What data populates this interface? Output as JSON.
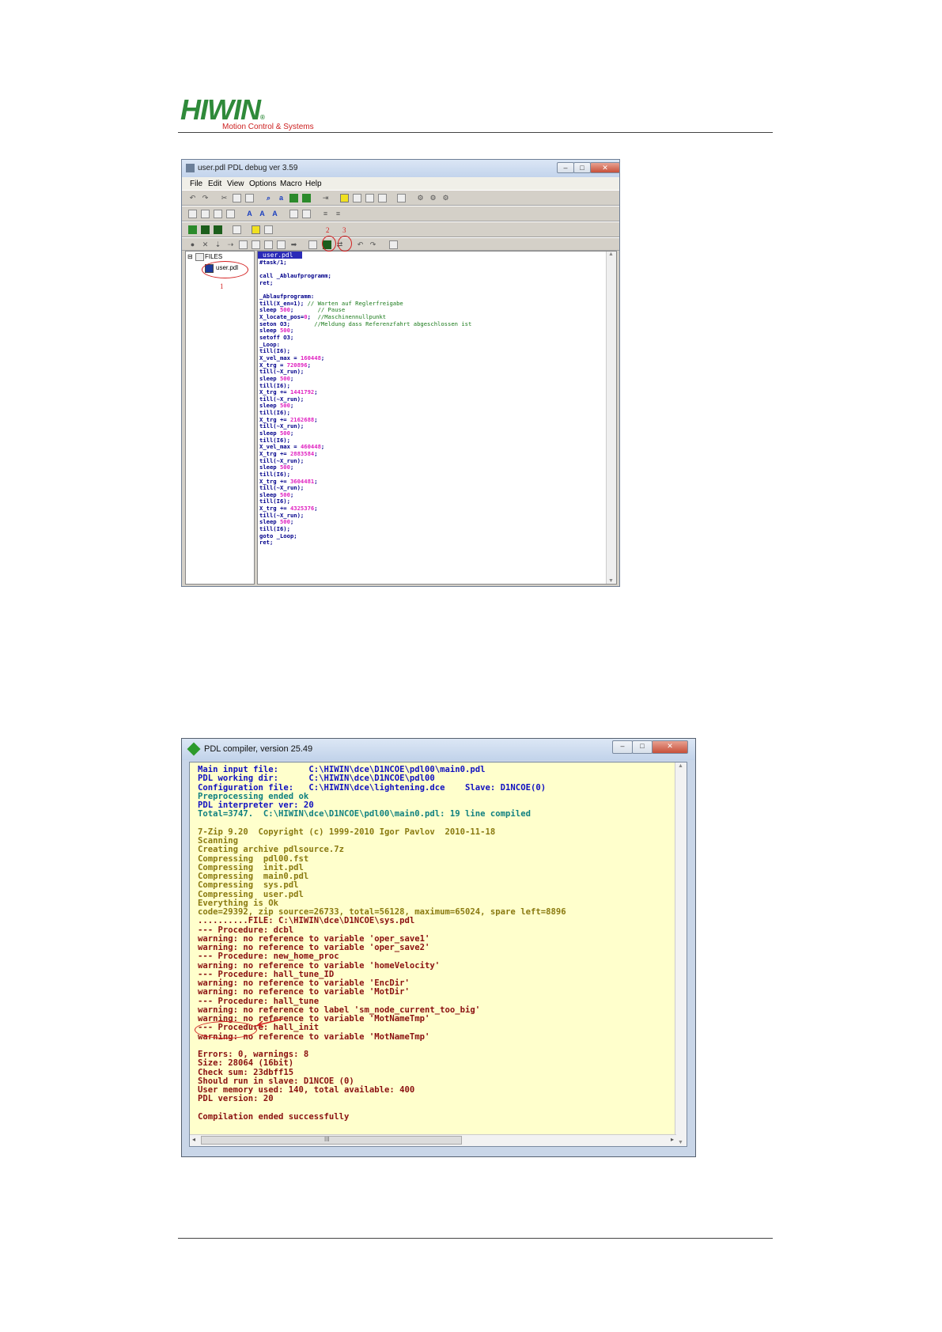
{
  "header": {
    "brand": "HIWIN",
    "brand_mark": "®",
    "tagline": "Motion Control & Systems"
  },
  "debugger": {
    "title": "user.pdl   PDL debug ver 3.59",
    "menu": [
      "File",
      "Edit",
      "View",
      "Options",
      "Macro",
      "Help"
    ],
    "tree_root": "FILES",
    "tree_file": "user.pdl",
    "editor_tab": "user.pdl",
    "annotations": [
      "1",
      "2",
      "3"
    ],
    "code_lines": [
      [
        [
          "#task/1;",
          "k"
        ]
      ],
      [
        [
          "",
          "k"
        ]
      ],
      [
        [
          "call _Ablaufprogramm;",
          "k"
        ]
      ],
      [
        [
          "ret;",
          "k"
        ]
      ],
      [
        [
          "",
          "k"
        ]
      ],
      [
        [
          "_Ablaufprogramm:",
          "k"
        ]
      ],
      [
        [
          "till(X_en=1); ",
          "k"
        ],
        [
          "// Warten auf Reglerfreigabe",
          "c"
        ]
      ],
      [
        [
          "sleep ",
          "k"
        ],
        [
          "500",
          "n"
        ],
        [
          ";       ",
          "k"
        ],
        [
          "// Pause",
          "c"
        ]
      ],
      [
        [
          "X_locate_pos=",
          "k"
        ],
        [
          "0",
          "n"
        ],
        [
          ";  ",
          "k"
        ],
        [
          "//Maschinennullpunkt",
          "c"
        ]
      ],
      [
        [
          "seton O3;       ",
          "k"
        ],
        [
          "//Meldung dass Referenzfahrt abgeschlossen ist",
          "c"
        ]
      ],
      [
        [
          "sleep ",
          "k"
        ],
        [
          "500",
          "n"
        ],
        [
          ";",
          "k"
        ]
      ],
      [
        [
          "setoff O3;",
          "k"
        ]
      ],
      [
        [
          "_Loop:",
          "k"
        ]
      ],
      [
        [
          "till(I6);",
          "k"
        ]
      ],
      [
        [
          "X_vel_max = ",
          "k"
        ],
        [
          "160448",
          "n"
        ],
        [
          ";",
          "k"
        ]
      ],
      [
        [
          "X_trg = ",
          "k"
        ],
        [
          "720896",
          "n"
        ],
        [
          ";",
          "k"
        ]
      ],
      [
        [
          "till(~X_run);",
          "k"
        ]
      ],
      [
        [
          "sleep ",
          "k"
        ],
        [
          "500",
          "n"
        ],
        [
          ";",
          "k"
        ]
      ],
      [
        [
          "till(I6);",
          "k"
        ]
      ],
      [
        [
          "X_trg += ",
          "k"
        ],
        [
          "1441792",
          "n"
        ],
        [
          ";",
          "k"
        ]
      ],
      [
        [
          "till(~X_run);",
          "k"
        ]
      ],
      [
        [
          "sleep ",
          "k"
        ],
        [
          "500",
          "n"
        ],
        [
          ";",
          "k"
        ]
      ],
      [
        [
          "till(I6);",
          "k"
        ]
      ],
      [
        [
          "X_trg += ",
          "k"
        ],
        [
          "2162688",
          "n"
        ],
        [
          ";",
          "k"
        ]
      ],
      [
        [
          "till(~X_run);",
          "k"
        ]
      ],
      [
        [
          "sleep ",
          "k"
        ],
        [
          "500",
          "n"
        ],
        [
          ";",
          "k"
        ]
      ],
      [
        [
          "till(I6);",
          "k"
        ]
      ],
      [
        [
          "X_vel_max = ",
          "k"
        ],
        [
          "460448",
          "n"
        ],
        [
          ";",
          "k"
        ]
      ],
      [
        [
          "X_trg += ",
          "k"
        ],
        [
          "2883584",
          "n"
        ],
        [
          ";",
          "k"
        ]
      ],
      [
        [
          "till(~X_run);",
          "k"
        ]
      ],
      [
        [
          "sleep ",
          "k"
        ],
        [
          "500",
          "n"
        ],
        [
          ";",
          "k"
        ]
      ],
      [
        [
          "till(I6);",
          "k"
        ]
      ],
      [
        [
          "X_trg += ",
          "k"
        ],
        [
          "3604481",
          "n"
        ],
        [
          ";",
          "k"
        ]
      ],
      [
        [
          "till(~X_run);",
          "k"
        ]
      ],
      [
        [
          "sleep ",
          "k"
        ],
        [
          "500",
          "n"
        ],
        [
          ";",
          "k"
        ]
      ],
      [
        [
          "till(I6);",
          "k"
        ]
      ],
      [
        [
          "X_trg += ",
          "k"
        ],
        [
          "4325376",
          "n"
        ],
        [
          ";",
          "k"
        ]
      ],
      [
        [
          "till(~X_run);",
          "k"
        ]
      ],
      [
        [
          "sleep ",
          "k"
        ],
        [
          "500",
          "n"
        ],
        [
          ";",
          "k"
        ]
      ],
      [
        [
          "till(I6);",
          "k"
        ]
      ],
      [
        [
          "goto _Loop;",
          "k"
        ]
      ],
      [
        [
          "ret;",
          "k"
        ]
      ]
    ]
  },
  "compiler": {
    "title": "PDL compiler, version 25.49",
    "scroll_mark": "III",
    "lines": [
      [
        "Main input file:      C:\\HIWIN\\dce\\D1NCOE\\pdl00\\main0.pdl",
        "blue"
      ],
      [
        "PDL working dir:      C:\\HIWIN\\dce\\D1NCOE\\pdl00",
        "blue"
      ],
      [
        "Configuration file:   C:\\HIWIN\\dce\\lightening.dce    Slave: D1NCOE(0)",
        "blue"
      ],
      [
        "Preprocessing ended ok",
        "teal"
      ],
      [
        "PDL interpreter ver: 20",
        "blue"
      ],
      [
        "Total=3747.  C:\\HIWIN\\dce\\D1NCOE\\pdl00\\main0.pdl: 19 line compiled",
        "teal"
      ],
      [
        "",
        "blue"
      ],
      [
        "7-Zip 9.20  Copyright (c) 1999-2010 Igor Pavlov  2010-11-18",
        "ol"
      ],
      [
        "Scanning",
        "ol"
      ],
      [
        "Creating archive pdlsource.7z",
        "ol"
      ],
      [
        "Compressing  pdl00.fst",
        "ol"
      ],
      [
        "Compressing  init.pdl",
        "ol"
      ],
      [
        "Compressing  main0.pdl",
        "ol"
      ],
      [
        "Compressing  sys.pdl",
        "ol"
      ],
      [
        "Compressing  user.pdl",
        "ol"
      ],
      [
        "Everything is Ok",
        "ol"
      ],
      [
        "code=29392, zip source=26733, total=56128, maximum=65024, spare left=8896",
        "ol"
      ],
      [
        "..........FILE: C:\\HIWIN\\dce\\D1NCOE\\sys.pdl",
        "red"
      ],
      [
        "--- Procedure: dcbl",
        "red"
      ],
      [
        "warning: no reference to variable 'oper_save1'",
        "red"
      ],
      [
        "warning: no reference to variable 'oper_save2'",
        "red"
      ],
      [
        "--- Procedure: new_home_proc",
        "red"
      ],
      [
        "warning: no reference to variable 'homeVelocity'",
        "red"
      ],
      [
        "--- Procedure: hall_tune_ID",
        "red"
      ],
      [
        "warning: no reference to variable 'EncDir'",
        "red"
      ],
      [
        "warning: no reference to variable 'MotDir'",
        "red"
      ],
      [
        "--- Procedure: hall_tune",
        "red"
      ],
      [
        "warning: no reference to label 'sm_node_current_too_big'",
        "red"
      ],
      [
        "warning: no reference to variable 'MotNameTmp'",
        "red"
      ],
      [
        "--- Procedure: hall_init",
        "red"
      ],
      [
        "warning: no reference to variable 'MotNameTmp'",
        "red"
      ],
      [
        "",
        "red"
      ],
      [
        "Errors: 0, warnings: 8",
        "red"
      ],
      [
        "Size: 28064 (16bit)",
        "red"
      ],
      [
        "Check sum: 23dbff15",
        "red"
      ],
      [
        "Should run in slave: D1NCOE (0)",
        "red"
      ],
      [
        "User memory used: 140, total available: 400",
        "red"
      ],
      [
        "PDL version: 20",
        "red"
      ],
      [
        "",
        "red"
      ],
      [
        "Compilation ended successfully",
        "red"
      ]
    ]
  }
}
